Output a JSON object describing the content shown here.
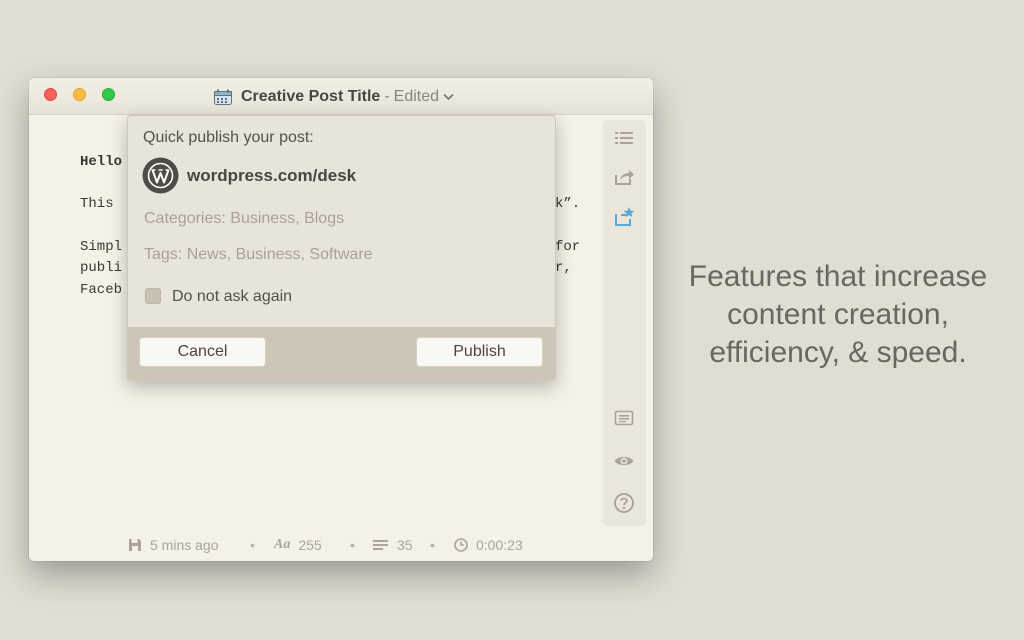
{
  "window": {
    "title": "Creative Post Title",
    "title_separator": "-",
    "title_state": "Edited"
  },
  "editor": {
    "lines": [
      "Hello",
      "This",
      "",
      "Simpl",
      "publi",
      "Faceb"
    ],
    "right_fragments": [
      "k”.",
      "for",
      "r,"
    ]
  },
  "publish_popover": {
    "heading": "Quick publish your post:",
    "site": "wordpress.com/desk",
    "categories": "Categories: Business, Blogs",
    "tags": "Tags: News, Business, Software",
    "do_not_ask": "Do not ask again",
    "do_not_ask_checked": false,
    "cancel_label": "Cancel",
    "publish_label": "Publish"
  },
  "sidebar": {
    "icons": [
      "list-icon",
      "share-icon",
      "publish-star-icon",
      "notes-icon",
      "preview-eye-icon",
      "help-icon"
    ],
    "active_color": "#5aaad2"
  },
  "status": {
    "saved": "5 mins ago",
    "characters": "255",
    "lines": "35",
    "time": "0:00:23",
    "separator": "•"
  },
  "promo": {
    "text": "Features that increase\ncontent creation,\nefficiency, & speed."
  }
}
